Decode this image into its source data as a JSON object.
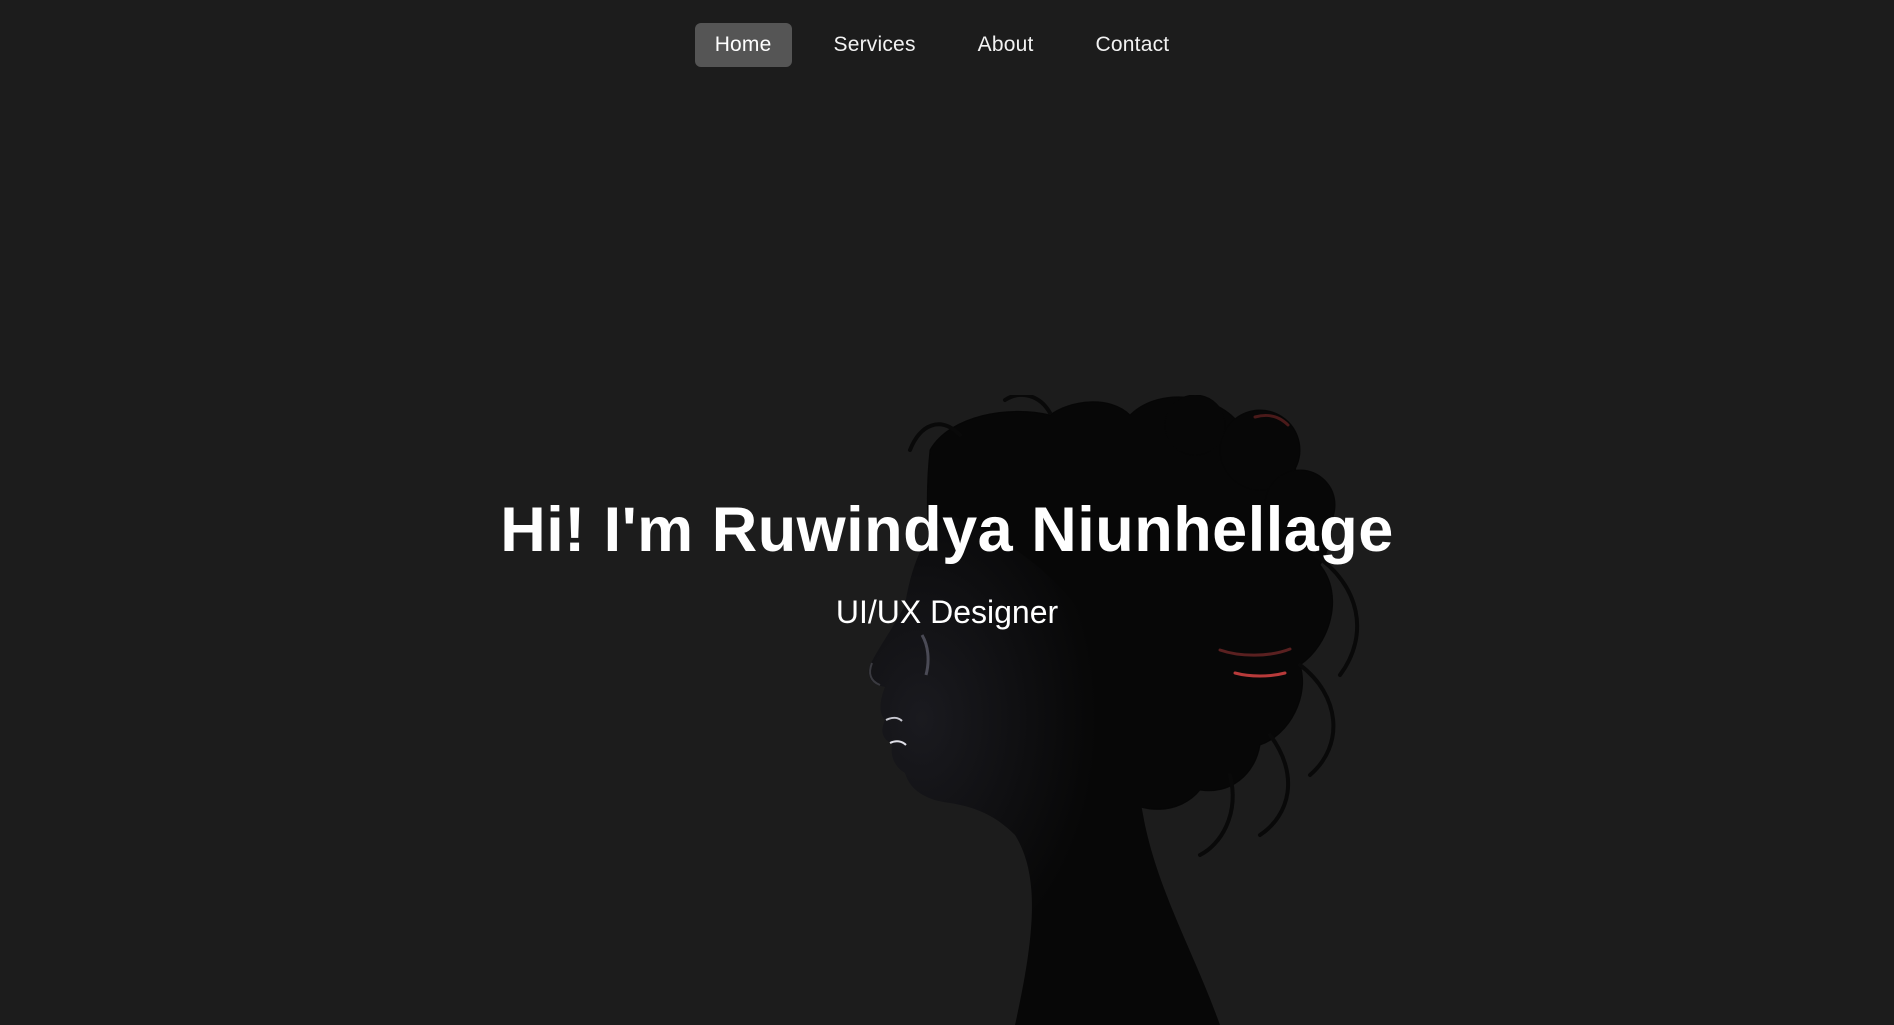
{
  "nav": {
    "items": [
      {
        "label": "Home",
        "active": true
      },
      {
        "label": "Services",
        "active": false
      },
      {
        "label": "About",
        "active": false
      },
      {
        "label": "Contact",
        "active": false
      }
    ]
  },
  "hero": {
    "title": "Hi! I'm Ruwindya Niunhellage",
    "subtitle": "UI/UX Designer"
  },
  "colors": {
    "background": "#1c1c1c",
    "nav_active_bg": "#555555",
    "text": "#ffffff",
    "silhouette": "#080808",
    "hair_accent": "#b83a3a"
  },
  "images": {
    "hero_background": "woman-profile-silhouette"
  }
}
